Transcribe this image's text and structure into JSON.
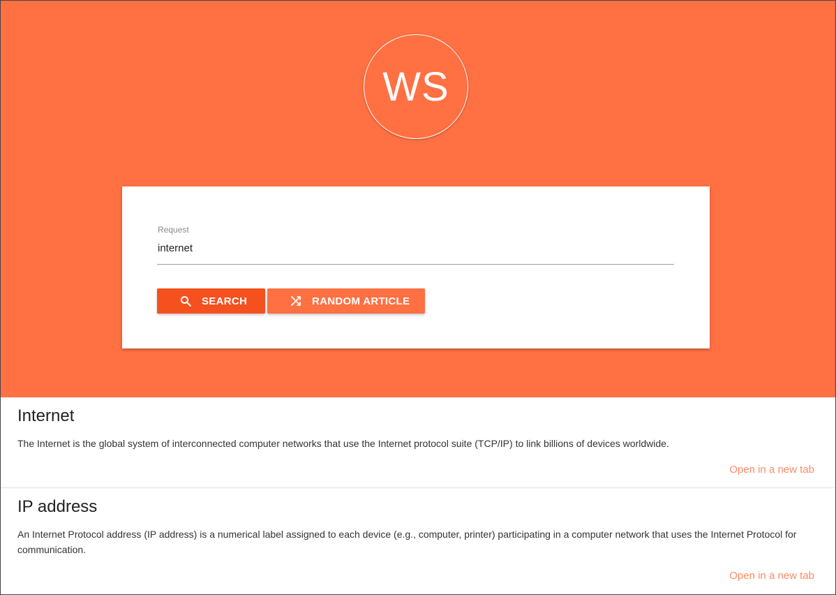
{
  "logo": {
    "text": "WS"
  },
  "search": {
    "label": "Request",
    "value": "internet",
    "search_button": "SEARCH",
    "random_button": "RANDOM ARTICLE"
  },
  "results": [
    {
      "title": "Internet",
      "snippet": "The Internet is the global system of interconnected computer networks that use the Internet protocol suite (TCP/IP) to link billions of devices worldwide.",
      "link": "Open in a new tab"
    },
    {
      "title": "IP address",
      "snippet": "An Internet Protocol address (IP address) is a numerical label assigned to each device (e.g., computer, printer) participating in a computer network that uses the Internet Protocol for communication.",
      "link": "Open in a new tab"
    }
  ],
  "colors": {
    "hero": "#ff7043",
    "search_button": "#f4511e",
    "random_button": "#ff7043",
    "link": "#ff8a65"
  },
  "icons": {
    "search_button": "search-icon",
    "random_button": "shuffle-icon"
  }
}
